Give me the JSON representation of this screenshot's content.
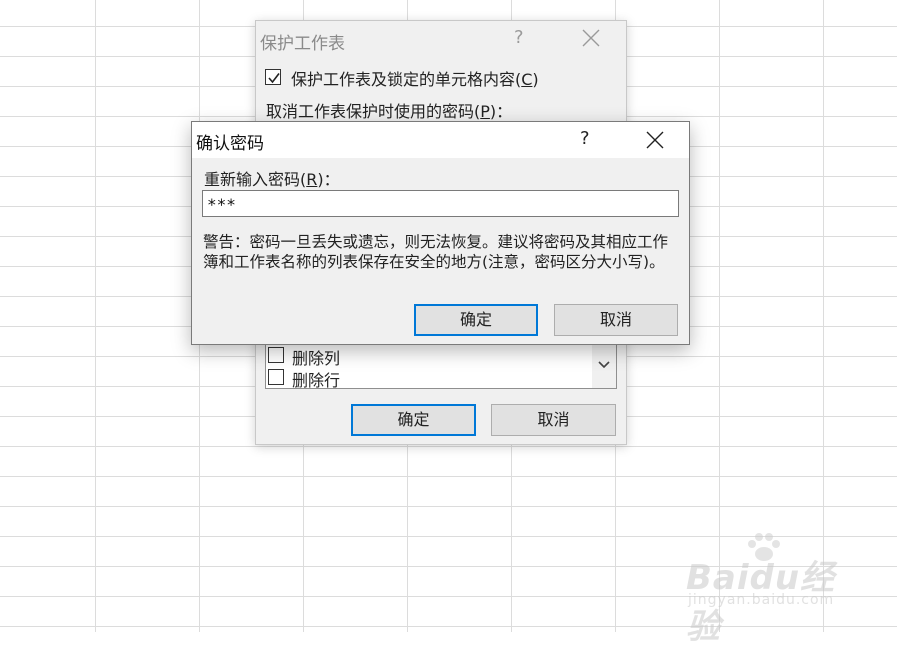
{
  "protect_dialog": {
    "title": "保护工作表",
    "help_glyph": "?",
    "protect_option": {
      "label_prefix": "保护工作表及锁定的单元格内容(",
      "accel": "C",
      "label_suffix": ")",
      "checked": true
    },
    "password_label": {
      "prefix": "取消工作表保护时使用的密码(",
      "accel": "P",
      "suffix": ")："
    },
    "permissions": [
      {
        "label": "删除列",
        "checked": false
      },
      {
        "label": "删除行",
        "checked": false
      }
    ],
    "ok_label": "确定",
    "cancel_label": "取消"
  },
  "confirm_dialog": {
    "title": "确认密码",
    "help_glyph": "?",
    "prompt": {
      "prefix": "重新输入密码(",
      "accel": "R",
      "suffix": ")："
    },
    "password_value": "***",
    "warning": "警告：密码一旦丢失或遗忘，则无法恢复。建议将密码及其相应工作簿和工作表名称的列表保存在安全的地方(注意，密码区分大小写)。",
    "ok_label": "确定",
    "cancel_label": "取消"
  },
  "watermark": {
    "brand": "Baidu经验",
    "url": "jingyan.baidu.com"
  },
  "colors": {
    "accent": "#0078d7",
    "dialog_bg": "#f0f0f0",
    "grid_line": "#dcdcdc"
  }
}
